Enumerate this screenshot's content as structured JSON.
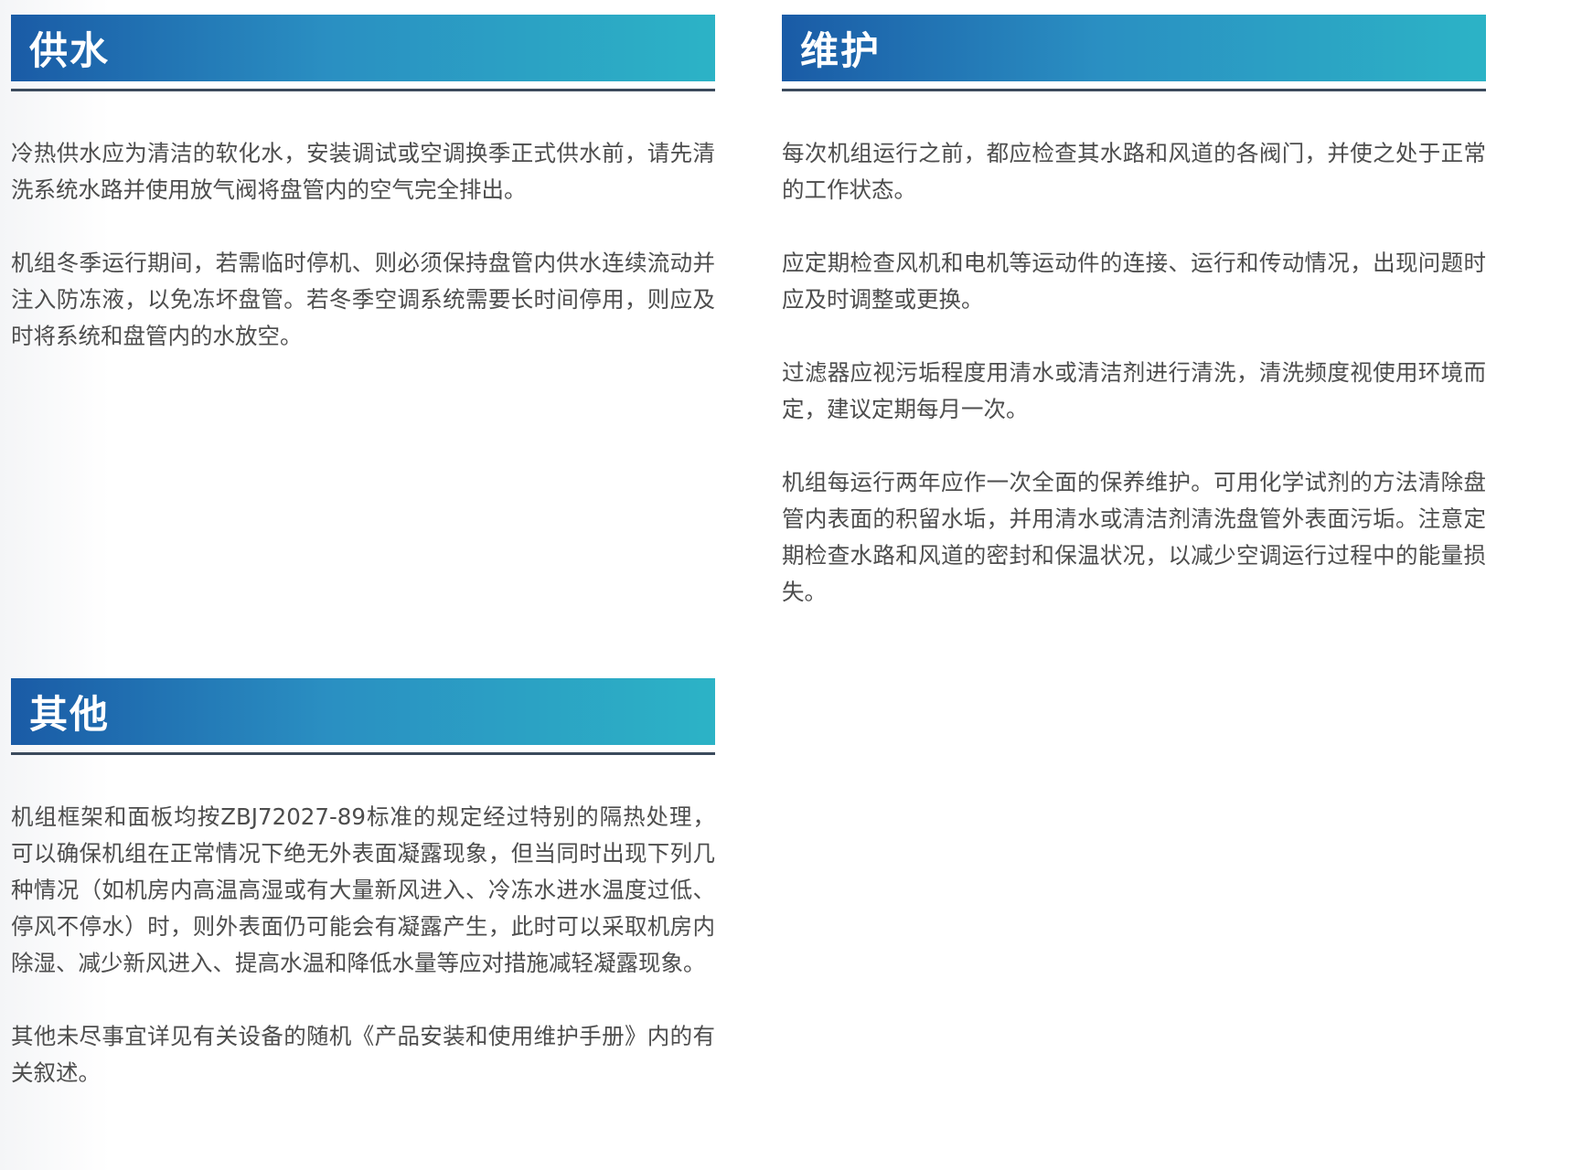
{
  "sections": {
    "water": {
      "title": "供水",
      "paragraphs": [
        "冷热供水应为清洁的软化水，安装调试或空调换季正式供水前，请先清洗系统水路并使用放气阀将盘管内的空气完全排出。",
        "机组冬季运行期间，若需临时停机、则必须保持盘管内供水连续流动并注入防冻液，以免冻坏盘管。若冬季空调系统需要长时间停用，则应及时将系统和盘管内的水放空。"
      ]
    },
    "maintenance": {
      "title": "维护",
      "paragraphs": [
        "每次机组运行之前，都应检查其水路和风道的各阀门，并使之处于正常的工作状态。",
        "应定期检查风机和电机等运动件的连接、运行和传动情况，出现问题时应及时调整或更换。",
        "过滤器应视污垢程度用清水或清洁剂进行清洗，清洗频度视使用环境而定，建议定期每月一次。",
        "机组每运行两年应作一次全面的保养维护。可用化学试剂的方法清除盘管内表面的积留水垢，并用清水或清洁剂清洗盘管外表面污垢。注意定期检查水路和风道的密封和保温状况，以减少空调运行过程中的能量损失。"
      ]
    },
    "other": {
      "title": "其他",
      "paragraphs": [
        "机组框架和面板均按ZBJ72027-89标准的规定经过特别的隔热处理，可以确保机组在正常情况下绝无外表面凝露现象，但当同时出现下列几种情况（如机房内高温高湿或有大量新风进入、冷冻水进水温度过低、停风不停水）时，则外表面仍可能会有凝露产生，此时可以采取机房内除湿、减少新风进入、提高水温和降低水量等应对措施减轻凝露现象。",
        "其他未尽事宜详见有关设备的随机《产品安装和使用维护手册》内的有关叙述。"
      ]
    }
  },
  "colors": {
    "header_gradient_start": "#1a5ba6",
    "header_gradient_mid": "#2a8fc2",
    "header_gradient_end": "#2cb3c6",
    "rule": "#3b4a5c",
    "body_text": "#4d4d4d"
  }
}
